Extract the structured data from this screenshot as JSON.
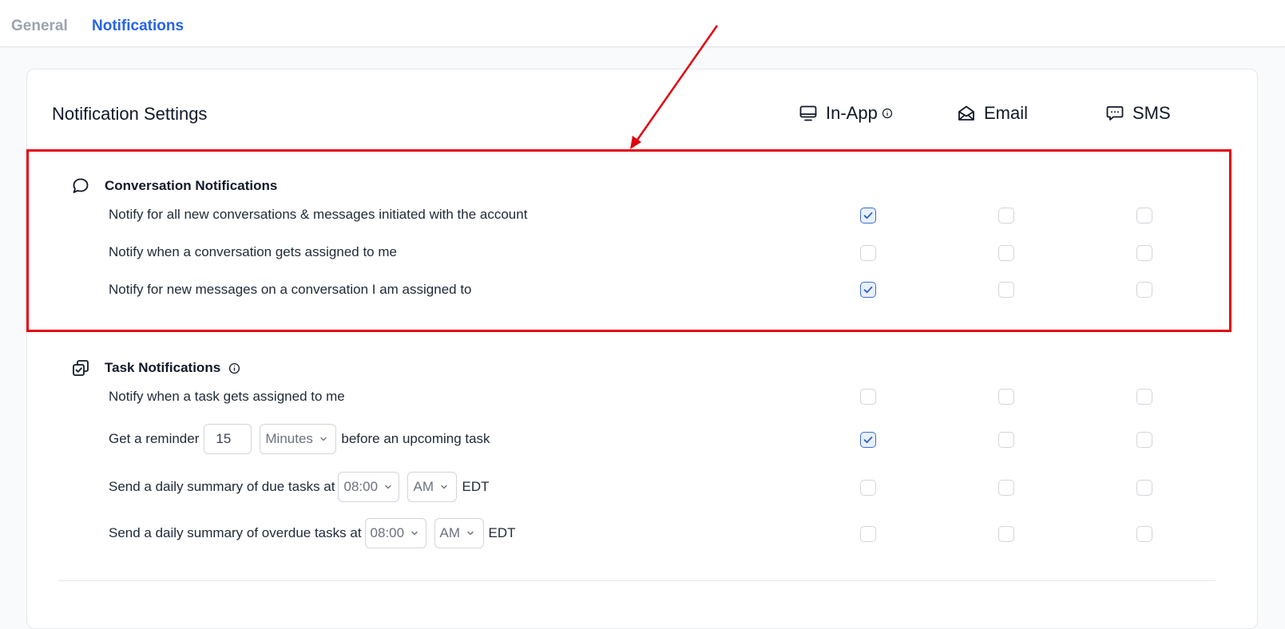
{
  "tabs": [
    {
      "label": "General",
      "active": false
    },
    {
      "label": "Notifications",
      "active": true
    }
  ],
  "card": {
    "title": "Notification Settings",
    "columns": [
      {
        "label": "In-App",
        "icon": "monitor-icon",
        "info": true
      },
      {
        "label": "Email",
        "icon": "envelope-open-icon",
        "info": false
      },
      {
        "label": "SMS",
        "icon": "chat-dots-icon",
        "info": false
      }
    ]
  },
  "conversation": {
    "title": "Conversation Notifications",
    "icon": "chat-bubble-icon",
    "rows": [
      {
        "label": "Notify for all new conversations & messages initiated with the account",
        "in_app": true,
        "email": false,
        "sms": false
      },
      {
        "label": "Notify when a conversation gets assigned to me",
        "in_app": false,
        "email": false,
        "sms": false
      },
      {
        "label": "Notify for new messages on a conversation I am assigned to",
        "in_app": true,
        "email": false,
        "sms": false
      }
    ]
  },
  "tasks": {
    "title": "Task Notifications",
    "icon": "task-copy-icon",
    "rows": [
      {
        "label": "Notify when a task gets assigned to me",
        "in_app": false,
        "email": false,
        "sms": false
      },
      {
        "prefix": "Get a reminder",
        "amount": "15",
        "unit": "Minutes",
        "suffix": "before an upcoming task",
        "in_app": true,
        "email": false,
        "sms": false
      },
      {
        "prefix": "Send a daily summary of due tasks at",
        "time": "08:00",
        "period": "AM",
        "tz": "EDT",
        "in_app": false,
        "email": false,
        "sms": false
      },
      {
        "prefix": "Send a daily summary of overdue tasks at",
        "time": "08:00",
        "period": "AM",
        "tz": "EDT",
        "in_app": false,
        "email": false,
        "sms": false
      }
    ]
  },
  "colors": {
    "accent": "#2563eb",
    "annotation": "#e3000f",
    "checked_bg": "#e8f0fd"
  }
}
